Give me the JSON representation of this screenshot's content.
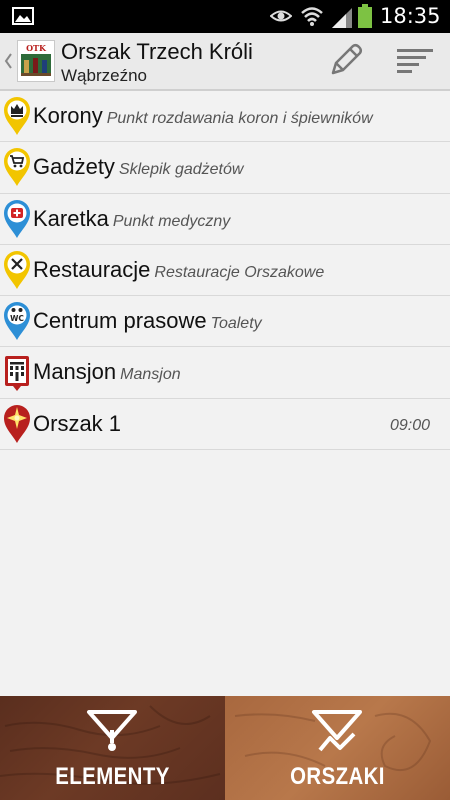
{
  "status_bar": {
    "time": "18:35",
    "icons": [
      "image-icon",
      "eye-icon",
      "wifi-icon",
      "signal-icon",
      "battery-icon"
    ]
  },
  "action_bar": {
    "title": "Orszak Trzech Króli",
    "subtitle": "Wąbrzeźno",
    "logo_text": "OTK",
    "icons": [
      "back-chevron-icon",
      "pencil-icon",
      "sort-icon"
    ]
  },
  "list": [
    {
      "name": "Korony",
      "desc": "Punkt rozdawania koron i śpiewników",
      "time": "",
      "icon": "crown-pin-icon",
      "pin_color": "#f2c500"
    },
    {
      "name": "Gadżety",
      "desc": "Sklepik gadżetów",
      "time": "",
      "icon": "cart-pin-icon",
      "pin_color": "#f2c500"
    },
    {
      "name": "Karetka",
      "desc": "Punkt medyczny",
      "time": "",
      "icon": "medical-pin-icon",
      "pin_color": "#2d8fd6"
    },
    {
      "name": "Restauracje",
      "desc": "Restauracje Orszakowe",
      "time": "",
      "icon": "cutlery-pin-icon",
      "pin_color": "#f2c500"
    },
    {
      "name": "Centrum prasowe",
      "desc": "Toalety",
      "time": "",
      "icon": "wc-pin-icon",
      "pin_color": "#2d8fd6"
    },
    {
      "name": "Mansjon",
      "desc": "Mansjon",
      "time": "",
      "icon": "building-pin-icon",
      "pin_color": "#b8201e"
    },
    {
      "name": "Orszak 1",
      "desc": "",
      "time": "09:00",
      "icon": "star-pin-icon",
      "pin_color": "#b8201e"
    }
  ],
  "tabs": [
    {
      "label": "ELEMENTY",
      "icon": "filter-pin-icon",
      "selected": true
    },
    {
      "label": "ORSZAKI",
      "icon": "filter-route-icon",
      "selected": false
    }
  ],
  "colors": {
    "status_bar": "#000000",
    "action_bar": "#eaeaea",
    "list_background": "#f2f2f2",
    "tab_elementy": "#5e3020",
    "tab_orszaki": "#aa6a40"
  }
}
